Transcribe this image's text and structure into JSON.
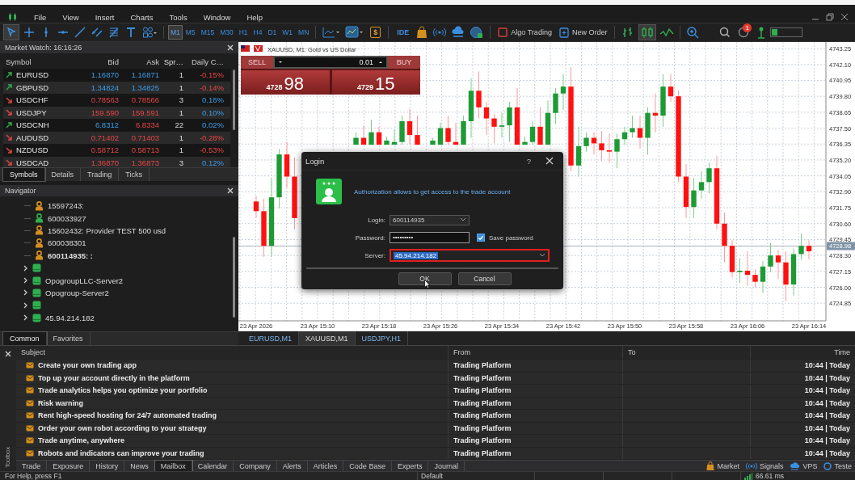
{
  "menu_bar": {
    "items": [
      "File",
      "View",
      "Insert",
      "Charts",
      "Tools",
      "Window",
      "Help"
    ]
  },
  "toolbar": {
    "timeframes": [
      {
        "label": "M1",
        "selected": true
      },
      {
        "label": "M5",
        "selected": false
      },
      {
        "label": "M15",
        "selected": false
      },
      {
        "label": "M30",
        "selected": false
      },
      {
        "label": "H1",
        "selected": false
      },
      {
        "label": "H4",
        "selected": false
      },
      {
        "label": "D1",
        "selected": false
      },
      {
        "label": "W1",
        "selected": false
      },
      {
        "label": "MN",
        "selected": false
      }
    ],
    "currency_symbol": "$",
    "ide": "IDE",
    "algo_trading": "Algo Trading",
    "new_order": "New Order",
    "notification_count": "1"
  },
  "market_watch": {
    "title": "Market Watch: 16:16:26",
    "columns": [
      "Symbol",
      "Bid",
      "Ask",
      "Spr…",
      "Daily C…"
    ],
    "rows": [
      {
        "symbol": "EURUSD",
        "rising": true,
        "bid": "1.16870",
        "bid_rising": true,
        "ask": "1.16871",
        "ask_rising": true,
        "spread": "1",
        "daily_change": "-0.15%",
        "change_rising": false
      },
      {
        "symbol": "GBPUSD",
        "rising": true,
        "bid": "1.34824",
        "bid_rising": true,
        "ask": "1.34825",
        "ask_rising": true,
        "spread": "1",
        "daily_change": "-0.14%",
        "change_rising": false
      },
      {
        "symbol": "USDCHF",
        "rising": false,
        "bid": "0.78563",
        "bid_rising": false,
        "ask": "0.78566",
        "ask_rising": false,
        "spread": "3",
        "daily_change": "0.16%",
        "change_rising": true
      },
      {
        "symbol": "USDJPY",
        "rising": false,
        "bid": "159.590",
        "bid_rising": false,
        "ask": "159.591",
        "ask_rising": false,
        "spread": "1",
        "daily_change": "0.10%",
        "change_rising": true
      },
      {
        "symbol": "USDCNH",
        "rising": true,
        "bid": "6.8312",
        "bid_rising": true,
        "ask": "6.8334",
        "ask_rising": false,
        "spread": "22",
        "daily_change": "0.02%",
        "change_rising": true
      },
      {
        "symbol": "AUDUSD",
        "rising": false,
        "bid": "0.71402",
        "bid_rising": false,
        "ask": "0.71403",
        "ask_rising": false,
        "spread": "1",
        "daily_change": "-0.28%",
        "change_rising": false
      },
      {
        "symbol": "NZDUSD",
        "rising": false,
        "bid": "0.58712",
        "bid_rising": false,
        "ask": "0.58713",
        "ask_rising": false,
        "spread": "1",
        "daily_change": "-0.53%",
        "change_rising": false
      },
      {
        "symbol": "USDCAD",
        "rising": false,
        "bid": "1.36870",
        "bid_rising": false,
        "ask": "1.36873",
        "ask_rising": false,
        "spread": "3",
        "daily_change": "0.12%",
        "change_rising": true
      }
    ],
    "tabs": [
      {
        "label": "Symbols",
        "selected": true
      },
      {
        "label": "Details",
        "selected": false
      },
      {
        "label": "Trading",
        "selected": false
      },
      {
        "label": "Ticks",
        "selected": false
      }
    ]
  },
  "navigator": {
    "title": "Navigator",
    "tree": [
      {
        "kind": "account",
        "label": "15597243:",
        "color": "#d4901e",
        "active": false
      },
      {
        "kind": "account",
        "label": "600033927",
        "color": "#2fae4f",
        "active": false
      },
      {
        "kind": "account",
        "label": "15602432: Provider TEST  500 usd",
        "color": "#d4901e",
        "active": false
      },
      {
        "kind": "account",
        "label": "600038301",
        "color": "#d4901e",
        "active": false
      },
      {
        "kind": "account",
        "label": "600114935: :",
        "color": "#d4901e",
        "active": true
      },
      {
        "kind": "server",
        "expanded": false
      },
      {
        "kind": "server",
        "label": "OpogroupLLC-Server2",
        "expanded": false
      },
      {
        "kind": "server",
        "label": "Opogroup-Server2",
        "expanded": false
      },
      {
        "kind": "server",
        "expanded": false
      },
      {
        "kind": "server",
        "label": "45.94.214.182",
        "expanded": false
      }
    ],
    "tabs": [
      {
        "label": "Common",
        "selected": true
      },
      {
        "label": "Favorites",
        "selected": false
      }
    ]
  },
  "chart": {
    "title": "XAUUSD, M1:  Gold vs US Dollar",
    "trade_panel": {
      "sell_label": "SELL",
      "buy_label": "BUY",
      "volume": "0.01",
      "sell_price_main": "4728",
      "sell_price_pips": "98",
      "buy_price_main": "4729",
      "buy_price_pips": "15"
    },
    "chart_data": {
      "type": "candlestick",
      "ylim": [
        4723.58,
        4743.72
      ],
      "grid": true,
      "ref_lines": [
        {
          "axis": "y",
          "value": 4728.98,
          "label": "4728.98"
        }
      ],
      "categories": [
        "23 Apr 2026",
        null,
        null,
        null,
        null,
        null,
        null,
        null,
        "23 Apr 15:10",
        null,
        null,
        null,
        null,
        null,
        null,
        null,
        "23 Apr 15:18",
        null,
        null,
        null,
        null,
        null,
        null,
        null,
        "23 Apr 15:26",
        null,
        null,
        null,
        null,
        null,
        null,
        null,
        "23 Apr 15:34",
        null,
        null,
        null,
        null,
        null,
        null,
        null,
        "23 Apr 15:42",
        null,
        null,
        null,
        null,
        null,
        null,
        null,
        "23 Apr 15:50",
        null,
        null,
        null,
        null,
        null,
        null,
        null,
        "23 Apr 15:58",
        null,
        null,
        null,
        null,
        null,
        null,
        null,
        "23 Apr 16:06",
        null,
        null,
        null,
        null,
        null,
        null,
        null,
        "23 Apr 16:14"
      ],
      "ohlc": [
        [
          4732.2,
          4732.6,
          4731.0,
          4731.5
        ],
        [
          4731.5,
          4732.4,
          4728.2,
          4729.0
        ],
        [
          4729.0,
          4733.9,
          4728.2,
          4732.5
        ],
        [
          4732.5,
          4736.0,
          4731.7,
          4735.6
        ],
        [
          4735.6,
          4736.5,
          4733.2,
          4734.0
        ],
        [
          4734.0,
          4735.4,
          4730.2,
          4731.0
        ],
        null,
        null,
        null,
        null,
        null,
        null,
        null,
        [
          4736.3,
          4737.2,
          4736.3,
          4736.8
        ],
        [
          4736.8,
          4737.7,
          4736.3,
          4736.3
        ],
        [
          4736.3,
          4738.1,
          4736.3,
          4737.2
        ],
        [
          4737.2,
          4737.6,
          4736.3,
          4736.3
        ],
        [
          4736.3,
          4736.9,
          4736.3,
          4736.6
        ],
        [
          4736.3,
          4737.4,
          4736.3,
          4736.5
        ],
        [
          4736.5,
          4738.4,
          4736.3,
          4738.0
        ],
        [
          4738.0,
          4738.9,
          4736.3,
          4737.0
        ],
        [
          4737.0,
          4738.4,
          4736.3,
          4736.3
        ],
        null,
        [
          4736.3,
          4736.8,
          4736.3,
          4736.6
        ],
        [
          4736.3,
          4737.9,
          4736.3,
          4737.5
        ],
        [
          4737.5,
          4738.4,
          4736.3,
          4736.5
        ],
        [
          4736.5,
          4737.9,
          4736.3,
          4736.3
        ],
        [
          4736.3,
          4738.4,
          4736.3,
          4738.0
        ],
        [
          4738.0,
          4741.1,
          4736.8,
          4740.2
        ],
        [
          4740.2,
          4741.6,
          4738.2,
          4739.0
        ],
        [
          4739.0,
          4739.4,
          4737.0,
          4738.2
        ],
        [
          4738.2,
          4738.5,
          4736.4,
          4737.6
        ],
        [
          4737.6,
          4738.6,
          4736.8,
          4737.7
        ],
        [
          4737.7,
          4739.4,
          4736.5,
          4739.0
        ],
        [
          4739.0,
          4740.4,
          4736.3,
          4736.3
        ],
        [
          4736.3,
          4736.9,
          4736.3,
          4736.5
        ],
        [
          4736.5,
          4738.0,
          4736.3,
          4737.6
        ],
        [
          4737.6,
          4739.0,
          4736.3,
          4736.3
        ],
        [
          4736.3,
          4739.5,
          4736.3,
          4738.6
        ],
        [
          4738.6,
          4740.4,
          4737.8,
          4740.0
        ],
        [
          4740.0,
          4741.4,
          4738.8,
          4740.5
        ],
        [
          4740.5,
          4741.9,
          4734.4,
          4734.8
        ],
        [
          4734.8,
          4737.6,
          4734.0,
          4736.2
        ],
        [
          4736.2,
          4737.2,
          4735.8,
          4736.8
        ],
        [
          4736.8,
          4737.2,
          4735.6,
          4736.4
        ],
        [
          4736.4,
          4737.3,
          4735.1,
          4735.9
        ],
        [
          4735.9,
          4737.1,
          4735.0,
          4735.8
        ],
        [
          4735.8,
          4737.1,
          4734.6,
          4736.7
        ],
        [
          4736.7,
          4737.6,
          4736.3,
          4737.2
        ],
        [
          4737.2,
          4738.4,
          4736.8,
          4737.5
        ],
        [
          4737.5,
          4738.4,
          4736.0,
          4736.8
        ],
        [
          4736.8,
          4739.0,
          4735.6,
          4738.6
        ],
        [
          4738.6,
          4740.0,
          4737.2,
          4738.4
        ],
        [
          4738.4,
          4741.4,
          4737.6,
          4740.5
        ],
        [
          4740.5,
          4741.4,
          4739.4,
          4739.8
        ],
        [
          4739.8,
          4740.2,
          4733.6,
          4734.0
        ],
        [
          4734.0,
          4734.9,
          4731.0,
          4731.8
        ],
        [
          4731.8,
          4733.9,
          4731.0,
          4733.0
        ],
        [
          4733.0,
          4734.4,
          4732.4,
          4733.6
        ],
        [
          4733.6,
          4735.0,
          4732.8,
          4734.6
        ],
        [
          4734.6,
          4735.5,
          4730.2,
          4730.6
        ],
        [
          4730.6,
          4731.4,
          4727.8,
          4729.0
        ],
        [
          4729.0,
          4729.4,
          4726.7,
          4727.1
        ],
        [
          4727.1,
          4728.1,
          4726.3,
          4727.2
        ],
        [
          4727.2,
          4728.6,
          4726.1,
          4726.9
        ],
        [
          4726.9,
          4727.3,
          4726.0,
          4726.4
        ],
        [
          4726.4,
          4727.9,
          4725.6,
          4727.5
        ],
        [
          4727.5,
          4729.2,
          4727.1,
          4728.3
        ],
        [
          4728.3,
          4728.7,
          4726.6,
          4727.8
        ],
        [
          4727.8,
          4728.6,
          4725.0,
          4726.2
        ],
        [
          4726.2,
          4728.8,
          4725.4,
          4728.4
        ],
        [
          4728.4,
          4729.9,
          4728.0,
          4729.0
        ],
        [
          4729.0,
          4729.4,
          4728.0,
          4728.6
        ]
      ],
      "yticks": [
        {
          "value": 4743.25,
          "label": "4743.25"
        },
        {
          "value": 4742.1,
          "label": "4742.10"
        },
        {
          "value": 4740.95,
          "label": "4740.95"
        },
        {
          "value": 4739.8,
          "label": "4739.80"
        },
        {
          "value": 4738.65,
          "label": "4738.65"
        },
        {
          "value": 4737.5,
          "label": "4737.50"
        },
        {
          "value": 4736.35,
          "label": "4736.35"
        },
        {
          "value": 4735.2,
          "label": "4735.20"
        },
        {
          "value": 4734.05,
          "label": "4734.05"
        },
        {
          "value": 4732.9,
          "label": "4732.90"
        },
        {
          "value": 4731.75,
          "label": "4731.75"
        },
        {
          "value": 4730.6,
          "label": "4730.60"
        },
        {
          "value": 4729.45,
          "label": "4729.45"
        },
        {
          "value": 4728.3,
          "label": "4728.30"
        },
        {
          "value": 4727.15,
          "label": "4727.15"
        },
        {
          "value": 4726.0,
          "label": "4726.00"
        },
        {
          "value": 4724.85,
          "label": "4724.85"
        }
      ]
    },
    "tabs": [
      {
        "label": "EURUSD,M1",
        "selected": false
      },
      {
        "label": "XAUUSD,M1",
        "selected": true
      },
      {
        "label": "USDJPY,H1",
        "selected": false
      }
    ]
  },
  "login_dialog": {
    "title": "Login",
    "help": "?",
    "message": "Authorization allows to get access to the trade account",
    "login_label": "Login:",
    "login_value": "600114935",
    "password_label": "Password:",
    "password_value": "•••••••••",
    "save_password": {
      "label": "Save password",
      "checked": true
    },
    "server_label": "Server:",
    "server_value": "45.94.214.182",
    "buttons": [
      "OK",
      "Cancel"
    ]
  },
  "toolbox": {
    "label": "Toolbox",
    "columns": [
      "Subject",
      "From",
      "To",
      "Time"
    ],
    "rows": [
      {
        "subject": "Create your own trading app",
        "from": "Trading Platform",
        "time": "10:44 | Today"
      },
      {
        "subject": "Top up your account directly in the platform",
        "from": "Trading Platform",
        "time": "10:44 | Today"
      },
      {
        "subject": "Trade analytics helps you optimize your portfolio",
        "from": "Trading Platform",
        "time": "10:44 | Today"
      },
      {
        "subject": "Risk warning",
        "from": "Trading Platform",
        "time": "10:44 | Today"
      },
      {
        "subject": "Rent high-speed hosting for 24/7 automated trading",
        "from": "Trading Platform",
        "time": "10:44 | Today"
      },
      {
        "subject": "Order your own robot according to your strategy",
        "from": "Trading Platform",
        "time": "10:44 | Today"
      },
      {
        "subject": "Trade anytime, anywhere",
        "from": "Trading Platform",
        "time": "10:44 | Today"
      },
      {
        "subject": "Robots and indicators can improve your trading",
        "from": "Trading Platform",
        "time": "10:44 | Today"
      }
    ],
    "tabs": [
      {
        "label": "Trade",
        "selected": false
      },
      {
        "label": "Exposure",
        "selected": false
      },
      {
        "label": "History",
        "selected": false
      },
      {
        "label": "News",
        "selected": false
      },
      {
        "label": "Mailbox",
        "selected": true
      },
      {
        "label": "Calendar",
        "selected": false
      },
      {
        "label": "Company",
        "selected": false
      },
      {
        "label": "Alerts",
        "selected": false
      },
      {
        "label": "Articles",
        "selected": false
      },
      {
        "label": "Code Base",
        "selected": false
      },
      {
        "label": "Experts",
        "selected": false
      },
      {
        "label": "Journal",
        "selected": false
      }
    ],
    "services": [
      {
        "kind": "market",
        "label": "Market"
      },
      {
        "kind": "signals",
        "label": "Signals"
      },
      {
        "kind": "vps",
        "label": "VPS"
      },
      {
        "kind": "tester",
        "label": "Teste"
      }
    ]
  },
  "status_bar": {
    "help": "For Help, press F1",
    "profile": "Default",
    "ping": "66.61 ms"
  }
}
